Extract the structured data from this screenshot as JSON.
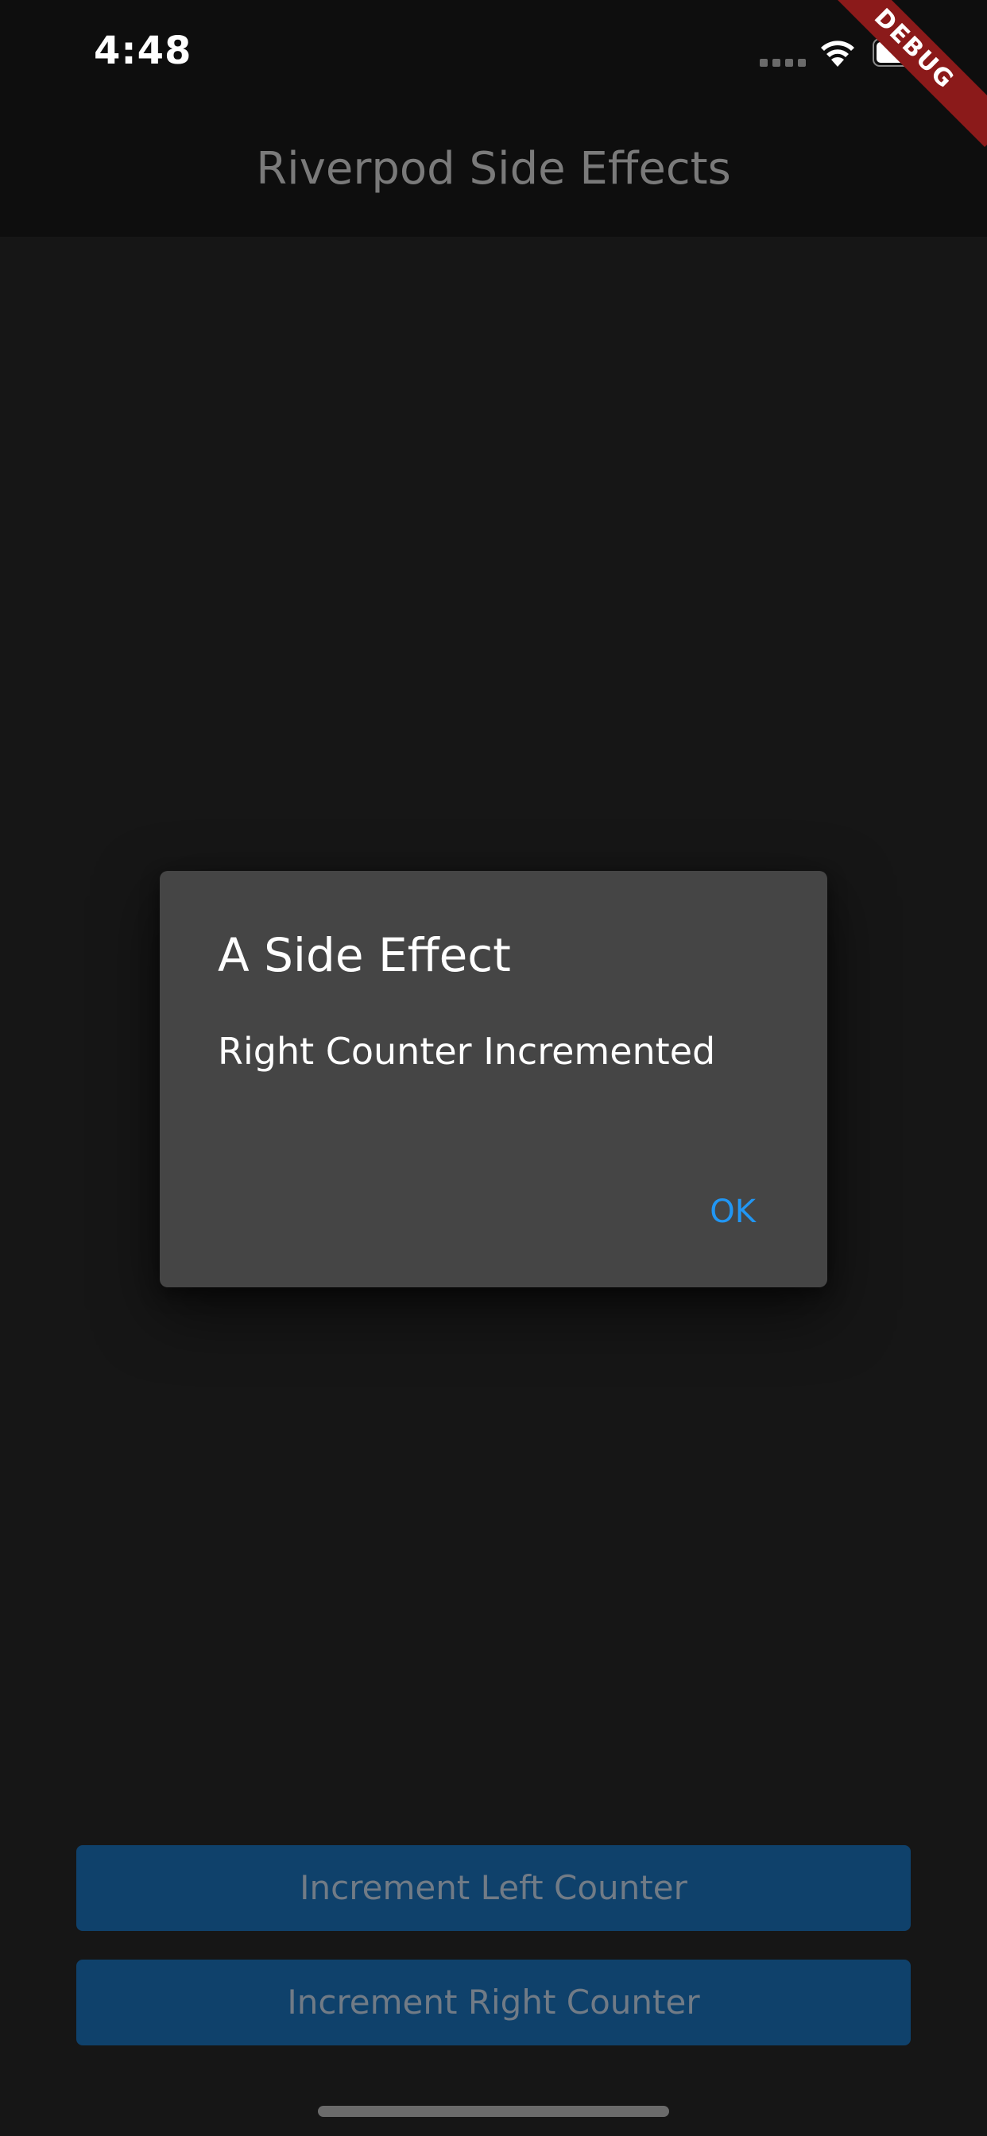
{
  "status_bar": {
    "time": "4:48",
    "icons": [
      "signal-icon",
      "wifi-icon",
      "battery-icon"
    ]
  },
  "debug_banner": "DEBUG",
  "app_bar": {
    "title": "Riverpod Side Effects"
  },
  "dialog": {
    "title": "A Side Effect",
    "content": "Right Counter Incremented",
    "ok_label": "OK"
  },
  "buttons": {
    "left_label": "Increment Left Counter",
    "right_label": "Increment Right Counter"
  },
  "colors": {
    "background": "#161616",
    "app_bar": "#0e0e0e",
    "dialog": "#454545",
    "accent": "#2196f3",
    "button": "#0f416b",
    "debug": "#8b1a1a"
  }
}
